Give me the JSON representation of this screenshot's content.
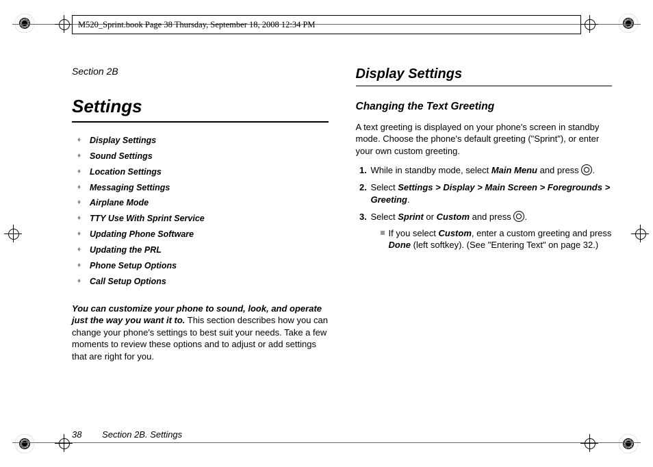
{
  "header": {
    "running_head": "M520_Sprint.book  Page 38  Thursday, September 18, 2008  12:34 PM"
  },
  "left": {
    "section_label": "Section 2B",
    "title": "Settings",
    "toc": [
      "Display Settings",
      "Sound Settings",
      "Location Settings",
      "Messaging Settings",
      "Airplane Mode",
      "TTY Use With Sprint Service",
      "Updating Phone Software",
      "Updating the PRL",
      "Phone Setup Options",
      "Call Setup Options"
    ],
    "intro_lead": "You can customize your phone to sound, look, and operate just the way you want it to.",
    "intro_rest": " This section describes how you can change your phone's settings to best suit your needs. Take a few moments to review these options and to adjust or add settings that are right for you."
  },
  "right": {
    "h2": "Display Settings",
    "h3": "Changing the Text Greeting",
    "p1": "A text greeting is displayed on your phone's screen in standby mode. Choose the phone's default greeting (\"Sprint\"), or enter your own custom greeting.",
    "step1_a": "While in standby mode, select ",
    "step1_b": "Main Menu",
    "step1_c": " and press ",
    "step2_a": "Select ",
    "step2_b": "Settings > Display > Main Screen > Foregrounds > Greeting",
    "step3_a": "Select ",
    "step3_b": "Sprint",
    "step3_c": " or ",
    "step3_d": "Custom",
    "step3_e": " and press ",
    "sub_a": "If you select ",
    "sub_b": "Custom",
    "sub_c": ", enter a custom greeting and press ",
    "sub_d": "Done",
    "sub_e": " (left softkey). (See \"Entering Text\" on page 32.)"
  },
  "footer": {
    "page_number": "38",
    "section_ref": "Section 2B. Settings"
  }
}
